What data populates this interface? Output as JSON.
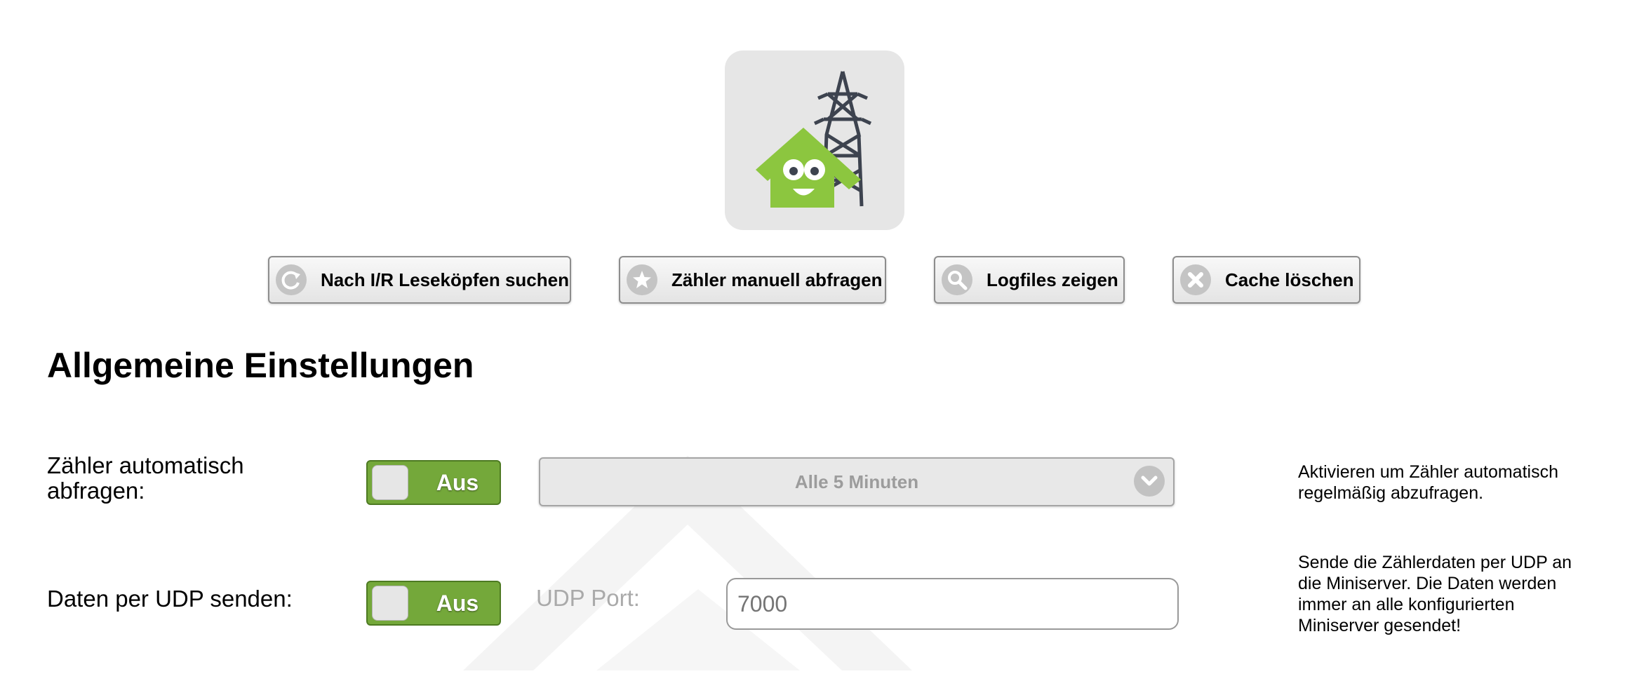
{
  "toolbar": {
    "buttons": [
      {
        "label": "Nach I/R Leseköpfen suchen",
        "icon": "refresh-icon"
      },
      {
        "label": "Zähler manuell abfragen",
        "icon": "star-icon"
      },
      {
        "label": "Logfiles zeigen",
        "icon": "search-icon"
      },
      {
        "label": "Cache löschen",
        "icon": "close-icon"
      }
    ]
  },
  "section": {
    "title": "Allgemeine Einstellungen"
  },
  "settings": {
    "auto_poll": {
      "label": "Zähler automatisch abfragen:",
      "toggle_label": "Aus",
      "interval_value": "Alle 5 Minuten",
      "help": "Aktivieren um Zähler automatisch regelmäßig abzufragen."
    },
    "udp": {
      "label": "Daten per UDP senden:",
      "toggle_label": "Aus",
      "port_label": "UDP Port:",
      "port_placeholder": "7000",
      "help": "Sende die Zählerdaten per UDP an die Miniserver. Die Daten werden immer an alle konfigurierten Miniserver gesendet!"
    }
  },
  "colors": {
    "accent_green": "#74a83a",
    "logo_green": "#8cc63f",
    "tower_gray": "#3d434f"
  },
  "icons": {
    "logo": "smartmeter-house-icon",
    "watermark": "house-watermark-icon",
    "dropdown": "chevron-down-icon"
  }
}
